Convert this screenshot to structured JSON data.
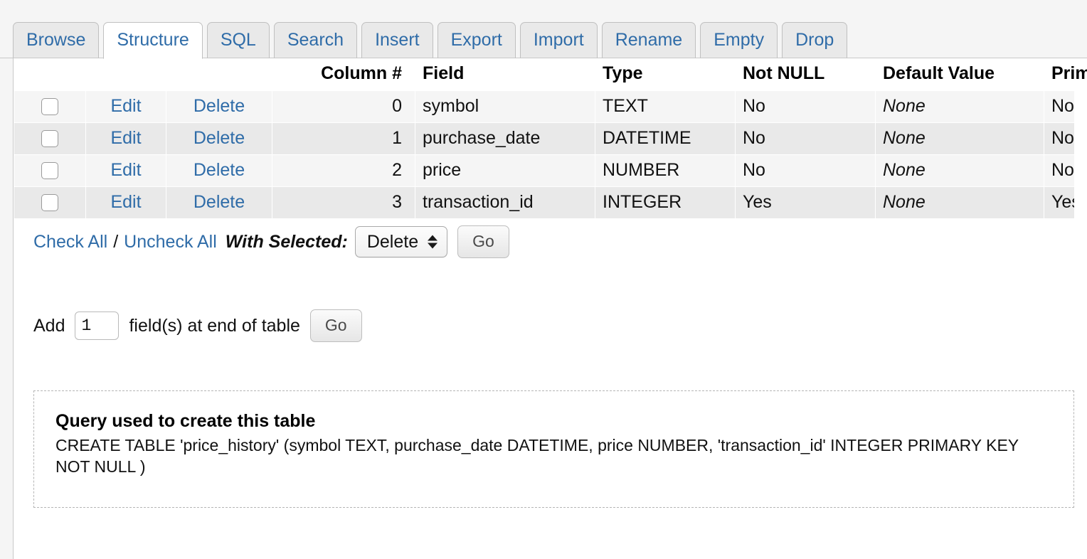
{
  "tabs": [
    {
      "label": "Browse",
      "active": false
    },
    {
      "label": "Structure",
      "active": true
    },
    {
      "label": "SQL",
      "active": false
    },
    {
      "label": "Search",
      "active": false
    },
    {
      "label": "Insert",
      "active": false
    },
    {
      "label": "Export",
      "active": false
    },
    {
      "label": "Import",
      "active": false
    },
    {
      "label": "Rename",
      "active": false
    },
    {
      "label": "Empty",
      "active": false
    },
    {
      "label": "Drop",
      "active": false
    }
  ],
  "structure_table": {
    "headers": {
      "checkbox": "",
      "edit": "",
      "delete": "",
      "column_number": "Column #",
      "field": "Field",
      "type": "Type",
      "not_null": "Not NULL",
      "default_value": "Default Value",
      "primary_key": "Primary Key"
    },
    "row_actions": {
      "edit": "Edit",
      "delete": "Delete"
    },
    "rows": [
      {
        "column_number": "0",
        "field": "symbol",
        "type": "TEXT",
        "not_null": "No",
        "default_value": "None",
        "primary_key": "No"
      },
      {
        "column_number": "1",
        "field": "purchase_date",
        "type": "DATETIME",
        "not_null": "No",
        "default_value": "None",
        "primary_key": "No"
      },
      {
        "column_number": "2",
        "field": "price",
        "type": "NUMBER",
        "not_null": "No",
        "default_value": "None",
        "primary_key": "No"
      },
      {
        "column_number": "3",
        "field": "transaction_id",
        "type": "INTEGER",
        "not_null": "Yes",
        "default_value": "None",
        "primary_key": "Yes"
      }
    ]
  },
  "with_selected": {
    "check_all": "Check All",
    "separator": "/",
    "uncheck_all": "Uncheck All",
    "label": "With Selected:",
    "selected_action": "Delete",
    "options": [
      "Delete"
    ],
    "go_label": "Go"
  },
  "add_field": {
    "prefix": "Add",
    "count": "1",
    "suffix": "field(s) at end of table",
    "go_label": "Go"
  },
  "query_box": {
    "title": "Query used to create this table",
    "sql": "CREATE TABLE 'price_history' (symbol TEXT, purchase_date DATETIME, price NUMBER, 'transaction_id' INTEGER PRIMARY KEY NOT NULL )"
  },
  "colors": {
    "link": "#2f6ca8",
    "page_background": "#f5f5f5",
    "panel_background": "#ffffff",
    "row_odd": "#f5f5f5",
    "row_even": "#e9e9e9",
    "tab_inactive": "#e9e9e9"
  }
}
